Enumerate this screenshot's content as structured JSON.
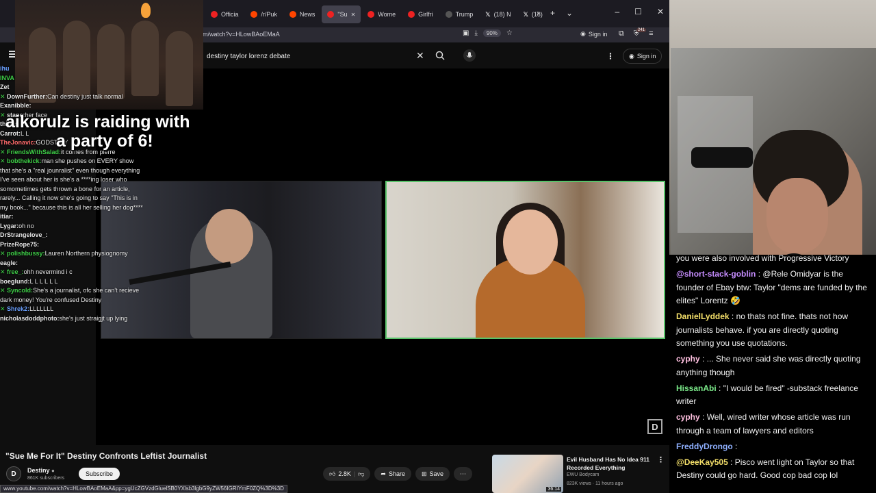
{
  "browser": {
    "tabs": [
      {
        "icon": "youtube-icon",
        "label": "Officia",
        "active": false
      },
      {
        "icon": "reddit-icon",
        "label": "/r/Puk",
        "active": false
      },
      {
        "icon": "reddit-icon",
        "label": "News",
        "active": false
      },
      {
        "icon": "youtube-icon",
        "label": "\"Su",
        "active": true
      },
      {
        "icon": "youtube-icon",
        "label": "Wome",
        "active": false
      },
      {
        "icon": "youtube-icon",
        "label": "Girlfri",
        "active": false
      },
      {
        "icon": "generic-icon",
        "label": "Trump",
        "active": false
      },
      {
        "icon": "x-icon",
        "label": "(18) N",
        "active": false
      },
      {
        "icon": "x-icon",
        "label": "(18)",
        "active": false
      }
    ],
    "url": "m/watch?v=HLowBAoEMaA",
    "zoom": "90%",
    "signin_label": "Sign in",
    "badge_count": "241",
    "status_url": "www.youtube.com/watch?v=HLowBAoEMaA&pp=ygUcZGVzdGluelSB0YXlsb3lgbG9yZW56IGRIYmF0ZQ%3D%3D"
  },
  "youtube": {
    "search_value": "destiny taylor lorenz debate",
    "signin_label": "Sign in",
    "video_title": "\"Sue Me For It\" Destiny Confronts Leftist Journalist",
    "channel_name": "Destiny",
    "channel_subs": "861K subscribers",
    "subscribe_label": "Subscribe",
    "likes": "2.8K",
    "share_label": "Share",
    "save_label": "Save",
    "related": {
      "title": "Evil Husband Has No Idea 911 Recorded Everything",
      "channel": "EWU Bodycam",
      "meta": "823K views · 11 hours ago",
      "duration": "36:14"
    }
  },
  "raid": {
    "line1": "aikorulz is raiding with",
    "line2": "a party of 6!"
  },
  "left_chat": [
    {
      "user": "ihu",
      "text": "",
      "color": "#6aa0ff",
      "check": false
    },
    {
      "user": "INVA",
      "text": "",
      "color": "#3ecf47",
      "check": false
    },
    {
      "user": "Zet",
      "text": "",
      "color": "#e8e8e8",
      "check": false
    },
    {
      "user": "DownFurther:",
      "text": "Can destiny just talk normal",
      "color": "#e8e8e8",
      "check": true
    },
    {
      "user": "Exanibble:",
      "text": "",
      "color": "#e8e8e8",
      "check": false
    },
    {
      "user": "stane:",
      "text": "her face",
      "color": "#e8e8e8",
      "check": true
    },
    {
      "user": "things",
      "text": "",
      "color": "#e8e8e8",
      "check": false
    },
    {
      "user": "Carrot:",
      "text": "L L",
      "color": "#e8e8e8",
      "check": false
    },
    {
      "user": "TheJonavic:",
      "text": "GODSTINY",
      "color": "#ff6b6b",
      "check": false
    },
    {
      "user": "FriendsWithSalad:",
      "text": "it comes from pierre",
      "color": "#3ecf47",
      "check": true
    },
    {
      "user": "bobthekick:",
      "text": "man she pushes on EVERY show that she's a \"real jounralist\" even though everything I've seen about her is she's a ****ing loser who somometimes gets thrown a bone for an article, rarely... Calling it now she's going to say \"This is in my book...\" because this is all her selling her dog****",
      "color": "#3ecf47",
      "check": true
    },
    {
      "user": "itiar:",
      "text": "",
      "color": "#e8e8e8",
      "check": false
    },
    {
      "user": "Lygar:",
      "text": "oh no",
      "color": "#e8e8e8",
      "check": false
    },
    {
      "user": "DrStrangelove_:",
      "text": "",
      "color": "#e8e8e8",
      "check": false
    },
    {
      "user": "PrizeRope75:",
      "text": "",
      "color": "#e8e8e8",
      "check": false
    },
    {
      "user": "polishbussy:",
      "text": "Lauren Northern physiognomy",
      "color": "#3ecf47",
      "check": true
    },
    {
      "user": "eagle:",
      "text": "",
      "color": "#e8e8e8",
      "check": false
    },
    {
      "user": "free_:",
      "text": "ohh nevermind i c",
      "color": "#3ecf47",
      "check": true
    },
    {
      "user": "boeglund:",
      "text": "L L L L L L",
      "color": "#e8e8e8",
      "check": false
    },
    {
      "user": "Syncold:",
      "text": "She's a journalist, ofc she can't recieve dark money! You're confused Destiny",
      "color": "#3ecf47",
      "check": true
    },
    {
      "user": "Shrek2:",
      "text": "LLLLLLL",
      "color": "#6aa0ff",
      "check": true
    },
    {
      "user": "nicholasdoddphoto:",
      "text": "she's just straigjt up lying",
      "color": "#e8e8e8",
      "check": false
    }
  ],
  "right_chat": [
    {
      "user": "",
      "text": "you were also involved with Progressive Victory",
      "color": "#f1f1f1"
    },
    {
      "user": "@short-stack-goblin",
      "text": ": @Rele Omidyar is the founder of Ebay btw: Taylor \"dems are funded by the elites\" Lorentz 🤣",
      "color": "#c68dff"
    },
    {
      "user": "DanielLyddek",
      "text": ": no thats not fine. thats not how journalists behave. if you are directly quoting something you use quotations.",
      "color": "#f5e06a"
    },
    {
      "user": "cyphy",
      "text": ": ... She never said she was directly quoting anything though",
      "color": "#ffc0e0"
    },
    {
      "user": "HissanAbi",
      "text": ": \"I would be fired\" -substack freelance writer",
      "color": "#7bea8a"
    },
    {
      "user": "cyphy",
      "text": ": Well, wired writer whose article was run through a team of lawyers and editors",
      "color": "#ffc0e0"
    },
    {
      "user": "FreddyDrongo",
      "text": ":",
      "color": "#8fb0ff"
    },
    {
      "user": "@DeeKay505",
      "text": ": Pisco went light on Taylor so that Destiny could go hard. Good cop bad cop lol",
      "color": "#f5e06a"
    }
  ]
}
